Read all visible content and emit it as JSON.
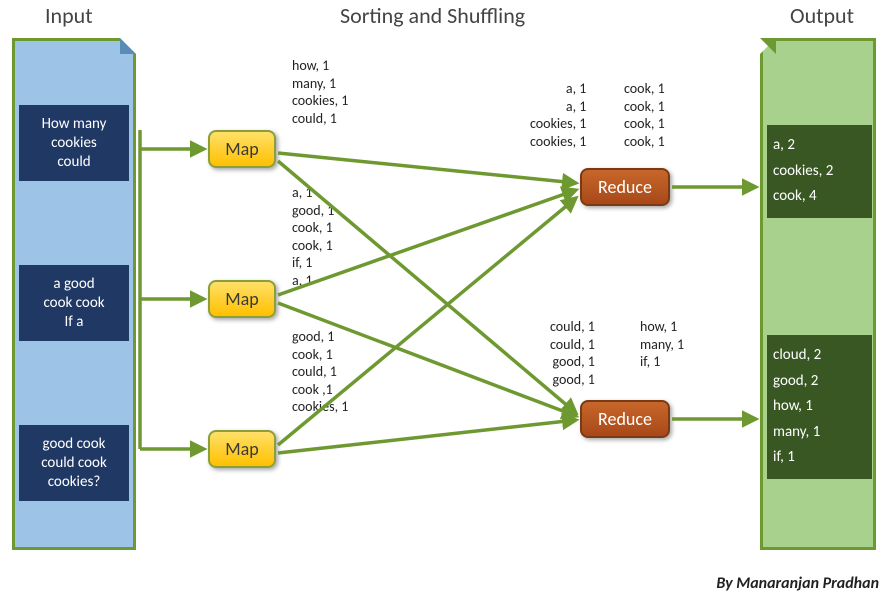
{
  "headers": {
    "input": "Input",
    "middle": "Sorting and Shuffling",
    "output": "Output"
  },
  "input_blocks": {
    "b1": "How many\ncookies\ncould",
    "b2": "a good\ncook cook\nIf a",
    "b3": "good cook\ncould cook\ncookies?"
  },
  "map_label": "Map",
  "reduce_label": "Reduce",
  "map_outputs": {
    "m1": "how, 1\nmany, 1\ncookies, 1\ncould, 1",
    "m2": "a, 1\ngood, 1\ncook, 1\ncook, 1\nif, 1\na, 1",
    "m3": "good, 1\ncook, 1\ncould, 1\ncook ,1\ncookies, 1"
  },
  "reduce_inputs": {
    "r1_left": "a, 1\na, 1\ncookies, 1\ncookies, 1",
    "r1_right": "cook, 1\ncook, 1\ncook, 1\ncook, 1",
    "r2_left": "could, 1\ncould, 1\ngood, 1\ngood, 1",
    "r2_right": "how, 1\nmany, 1\nif, 1"
  },
  "output_blocks": {
    "o1": "a, 2\ncookies, 2\ncook, 4",
    "o2": "cloud, 2\ngood, 2\nhow, 1\nmany, 1\nif, 1"
  },
  "byline": "By Manaranjan Pradhan"
}
